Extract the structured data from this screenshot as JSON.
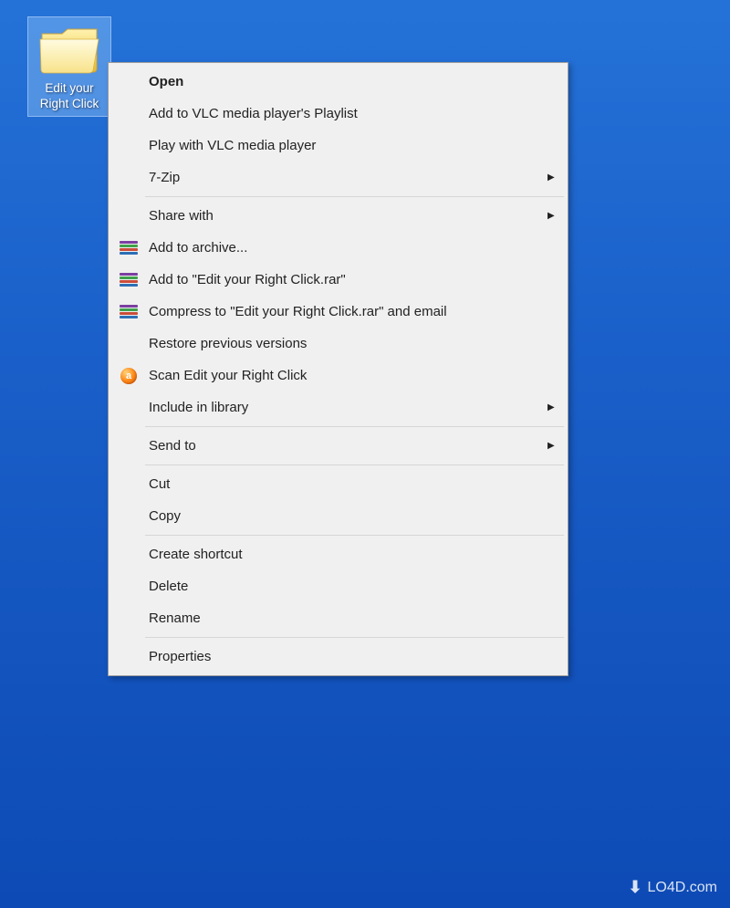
{
  "desktop": {
    "icon_label": "Edit your Right Click"
  },
  "menu": {
    "open": "Open",
    "vlc_add": "Add to VLC media player's Playlist",
    "vlc_play": "Play with VLC media player",
    "sevenzip": "7-Zip",
    "share_with": "Share with",
    "add_archive": "Add to archive...",
    "add_rar": "Add to \"Edit your Right Click.rar\"",
    "compress_email": "Compress to \"Edit your Right Click.rar\" and email",
    "restore": "Restore previous versions",
    "scan": "Scan Edit your Right Click",
    "include_lib": "Include in library",
    "send_to": "Send to",
    "cut": "Cut",
    "copy": "Copy",
    "create_shortcut": "Create shortcut",
    "delete": "Delete",
    "rename": "Rename",
    "properties": "Properties"
  },
  "watermark": {
    "text": "LO4D.com"
  }
}
